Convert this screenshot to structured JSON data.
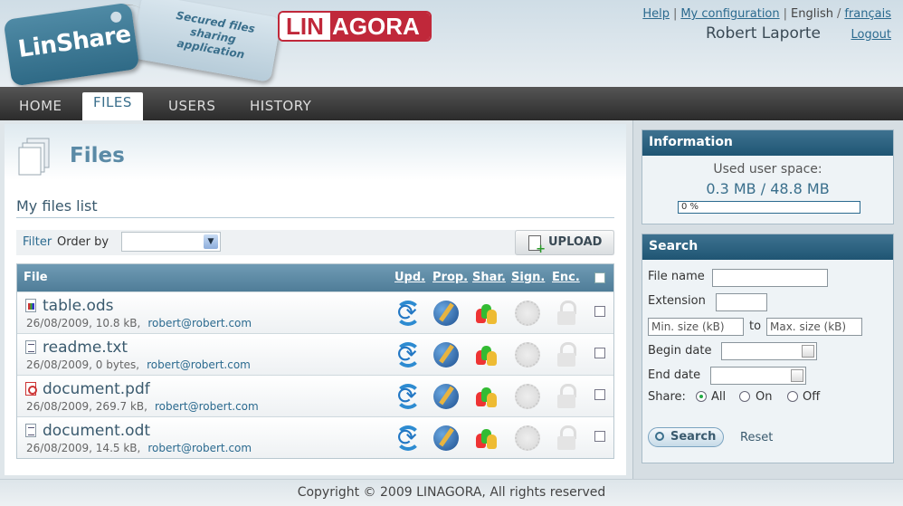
{
  "brand": {
    "logo_text": "LinShare",
    "tagline": "Secured files sharing application",
    "company_logo_left": "LIN",
    "company_logo_right": "AGORA"
  },
  "header": {
    "help": "Help",
    "my_configuration": "My configuration",
    "lang_current": "English",
    "lang_other": "français",
    "user_name": "Robert Laporte",
    "logout": "Logout"
  },
  "nav": {
    "tabs": [
      {
        "label": "HOME"
      },
      {
        "label": "FILES"
      },
      {
        "label": "USERS"
      },
      {
        "label": "HISTORY"
      }
    ],
    "active": "FILES"
  },
  "main": {
    "title": "Files",
    "subtitle": "My files list",
    "filter": "Filter",
    "order_by": "Order by",
    "upload": "UPLOAD",
    "columns": {
      "file": "File",
      "upd": "Upd.",
      "prop": "Prop.",
      "shar": "Shar.",
      "sign": "Sign.",
      "enc": "Enc."
    },
    "files": [
      {
        "name": "table.ods",
        "date": "26/08/2009, 10.8 kB,",
        "owner": "robert@robert.com",
        "type": "ods"
      },
      {
        "name": "readme.txt",
        "date": "26/08/2009, 0 bytes,",
        "owner": "robert@robert.com",
        "type": "txt"
      },
      {
        "name": "document.pdf",
        "date": "26/08/2009, 269.7 kB,",
        "owner": "robert@robert.com",
        "type": "pdf"
      },
      {
        "name": "document.odt",
        "date": "26/08/2009, 14.5 kB,",
        "owner": "robert@robert.com",
        "type": "odt"
      }
    ]
  },
  "info": {
    "title": "Information",
    "used_label": "Used user space:",
    "amount": "0.3 MB / 48.8 MB",
    "progress_text": "0 %",
    "progress_fraction": 0.0
  },
  "search": {
    "title": "Search",
    "file_name": "File name",
    "extension": "Extension",
    "min_placeholder": "Min. size (kB)",
    "to": "to",
    "max_placeholder": "Max. size (kB)",
    "begin_date": "Begin date",
    "end_date": "End date",
    "share": "Share:",
    "opt_all": "All",
    "opt_on": "On",
    "opt_off": "Off",
    "selected": "All",
    "search_btn": "Search",
    "reset": "Reset"
  },
  "footer": {
    "copyright": "Copyright © 2009 LINAGORA, All rights reserved"
  },
  "colors": {
    "accent": "#3a6f8c",
    "nav_bg": "#2b2b2b",
    "brand_red": "#c0283a"
  }
}
